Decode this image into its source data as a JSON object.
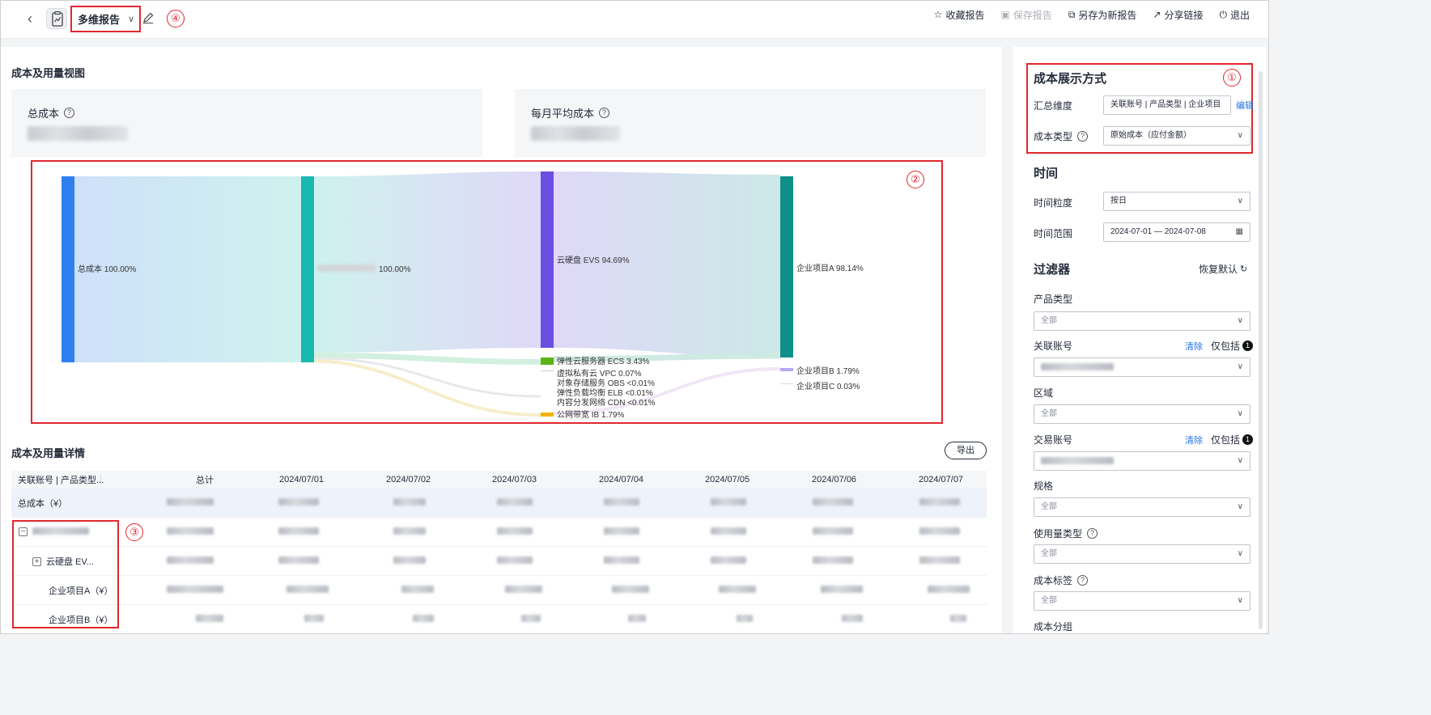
{
  "header": {
    "report_title": "多维报告",
    "actions": [
      {
        "label": "收藏报告",
        "icon": "star-icon",
        "disabled": false
      },
      {
        "label": "保存报告",
        "icon": "save-icon",
        "disabled": true
      },
      {
        "label": "另存为新报告",
        "icon": "save-as-icon",
        "disabled": false
      },
      {
        "label": "分享链接",
        "icon": "share-icon",
        "disabled": false
      },
      {
        "label": "退出",
        "icon": "power-icon",
        "disabled": false
      }
    ]
  },
  "callouts": [
    "①",
    "②",
    "③",
    "④"
  ],
  "main": {
    "view_title": "成本及用量视图",
    "kpis": [
      {
        "label": "总成本"
      },
      {
        "label": "每月平均成本"
      }
    ],
    "sankey": {
      "labels": [
        "总成本 100.00%",
        "100.00%",
        "云硬盘 EVS 94.69%",
        "弹性云服务器 ECS 3.43%",
        "虚拟私有云 VPC 0.07%",
        "对象存储服务 OBS <0.01%",
        "弹性负载均衡 ELB <0.01%",
        "内容分发网络 CDN <0.01%",
        "公网带宽 IB 1.79%",
        "企业项目A 98.14%",
        "企业项目B 1.79%",
        "企业项目C 0.03%"
      ],
      "colors": {
        "total": "#2f7ff0",
        "account": "#19b8b0",
        "evs": "#6a4fe0",
        "ecs": "#5cb318",
        "ib": "#f0b400",
        "projA": "#0f8f8a",
        "projB": "#b7a7f4",
        "projC": "#eeeeee"
      }
    },
    "detail_title": "成本及用量详情",
    "export_label": "导出",
    "table": {
      "headers": [
        "关联账号 | 产品类型...",
        "总计",
        "2024/07/01",
        "2024/07/02",
        "2024/07/03",
        "2024/07/04",
        "2024/07/05",
        "2024/07/06",
        "2024/07/07"
      ],
      "rows": [
        {
          "label": "总成本（¥）"
        },
        {
          "label": ""
        },
        {
          "label": "云硬盘 EV..."
        },
        {
          "label": "企业项目A（¥）"
        },
        {
          "label": "企业项目B（¥）"
        }
      ]
    }
  },
  "right": {
    "cost_display_title": "成本展示方式",
    "summary_dim_label": "汇总维度",
    "summary_dim_value": "关联账号 | 产品类型 | 企业项目",
    "edit_label": "编辑",
    "cost_type_label": "成本类型",
    "cost_type_value": "原始成本（应付金额）",
    "time_title": "时间",
    "granularity_label": "时间粒度",
    "granularity_value": "按日",
    "range_label": "时间范围",
    "range_value": "2024-07-01 — 2024-07-08",
    "filter_title": "过滤器",
    "restore_label": "恢复默认",
    "filters": {
      "product_type": {
        "label": "产品类型",
        "value": "全部"
      },
      "linked_account": {
        "label": "关联账号",
        "clear": "清除",
        "only": "仅包括",
        "badge": "1"
      },
      "region": {
        "label": "区域",
        "value": "全部"
      },
      "trade_account": {
        "label": "交易账号",
        "clear": "清除",
        "only": "仅包括",
        "badge": "1"
      },
      "spec": {
        "label": "规格",
        "value": "全部"
      },
      "usage_type": {
        "label": "使用量类型",
        "value": "全部"
      },
      "cost_tag": {
        "label": "成本标签",
        "value": "全部"
      },
      "cost_group": {
        "label": "成本分组"
      }
    }
  }
}
